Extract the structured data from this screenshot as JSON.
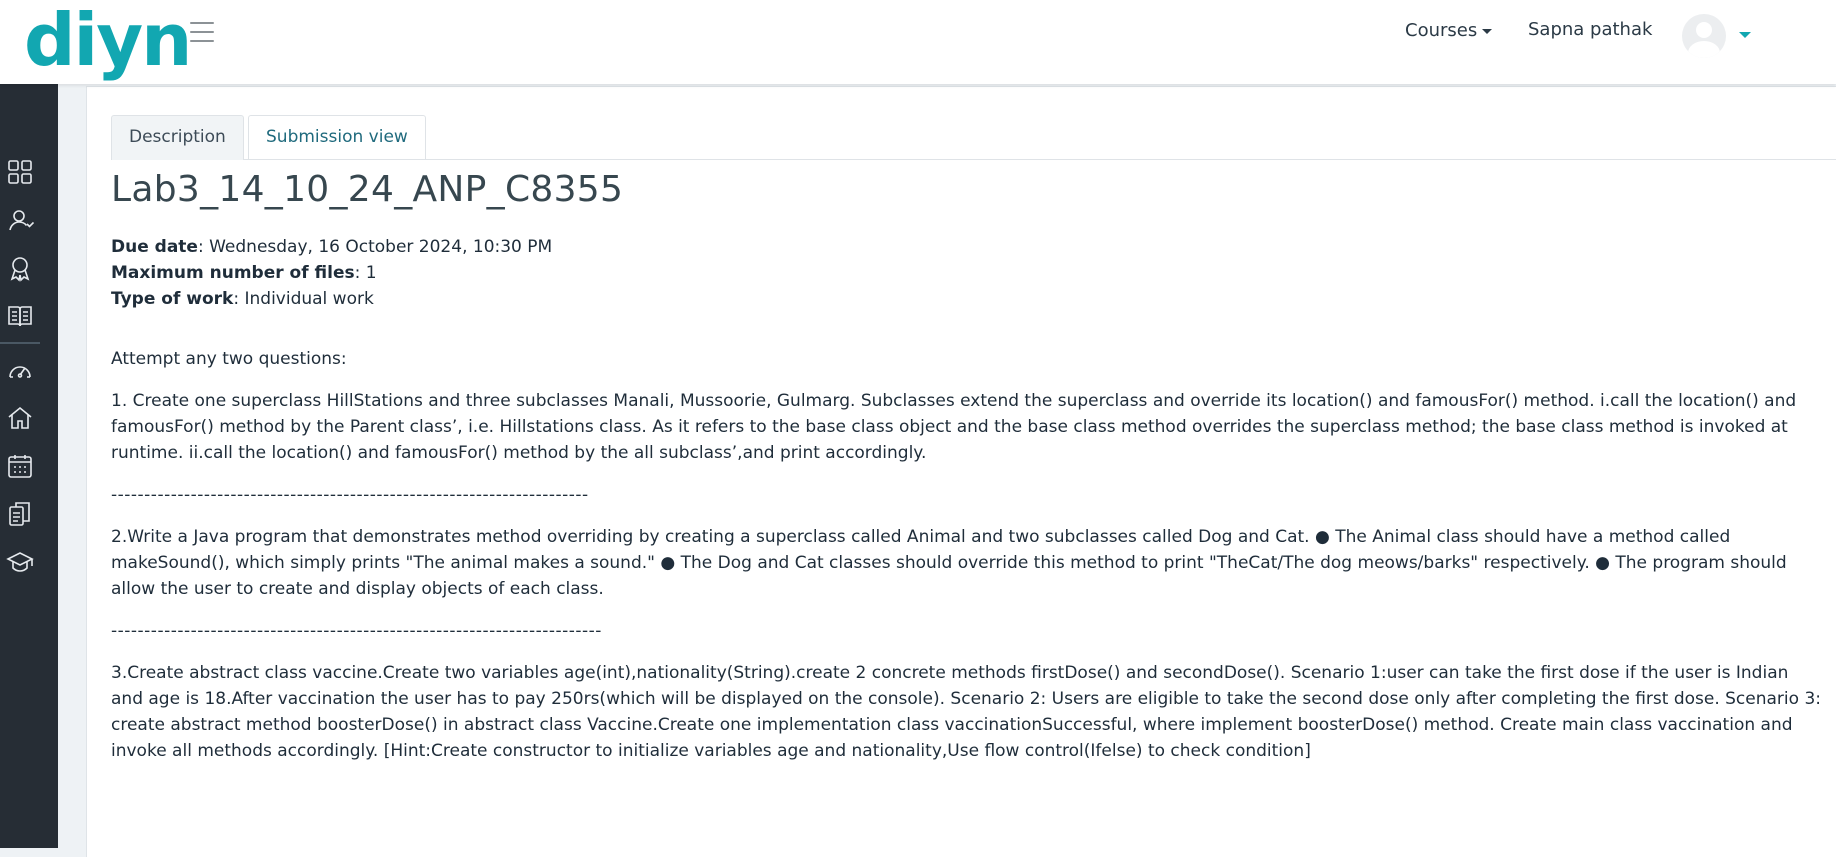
{
  "header": {
    "logo_text": "diyn",
    "courses_label": "Courses",
    "user_name": "Sapna pathak"
  },
  "sidebar": {
    "icons": [
      "dashboard-grid-icon",
      "user-icon",
      "badge-icon",
      "book-icon",
      "speedometer-icon",
      "home-icon",
      "calendar-icon",
      "copy-icon",
      "graduation-cap-icon"
    ]
  },
  "tabs": {
    "description": "Description",
    "submission_view": "Submission view"
  },
  "assignment": {
    "title": "Lab3_14_10_24_ANP_C8355",
    "due_date_label": "Due date",
    "due_date_value": ": Wednesday, 16 October 2024, 10:30 PM",
    "max_files_label": "Maximum number of files",
    "max_files_value": ": 1",
    "work_type_label": "Type of work",
    "work_type_value": ": Individual work"
  },
  "body": {
    "intro": "Attempt any two questions:",
    "q1": "1. Create one superclass HillStations and three subclasses Manali, Mussoorie, Gulmarg. Subclasses extend the superclass and override its location() and famousFor() method. i.call the location() and famousFor() method by the Parent class’, i.e. Hillstations class. As it refers to the base class object and the base class method overrides the superclass method; the base class method is invoked at runtime. ii.call the location() and famousFor() method by the all subclass’,and print accordingly.",
    "divider1": "------------------------------------------------------------------------",
    "q2": "2.Write a Java program that demonstrates method overriding by creating a superclass called Animal and two subclasses called Dog and Cat. ● The Animal class should have a method called makeSound(), which simply prints \"The animal makes a sound.\" ● The Dog and Cat classes should override this method to print \"TheCat/The dog meows/barks\" respectively. ● The program should allow the user to create and display objects of each class.",
    "divider2": "--------------------------------------------------------------------------",
    "q3": "3.Create abstract class vaccine.Create two variables age(int),nationality(String).create 2 concrete methods firstDose() and secondDose(). Scenario 1:user can take the first dose if the user is Indian and age is 18.After vaccination the user has to pay 250rs(which will be displayed on the console). Scenario 2: Users are eligible to take the second dose only after completing the first dose. Scenario 3: create abstract method boosterDose() in abstract class Vaccine.Create one implementation class vaccinationSuccessful, where implement boosterDose() method. Create main class vaccination and invoke all methods accordingly. [Hint:Create constructor to initialize variables age and nationality,Use flow control(Ifelse) to check condition]"
  }
}
